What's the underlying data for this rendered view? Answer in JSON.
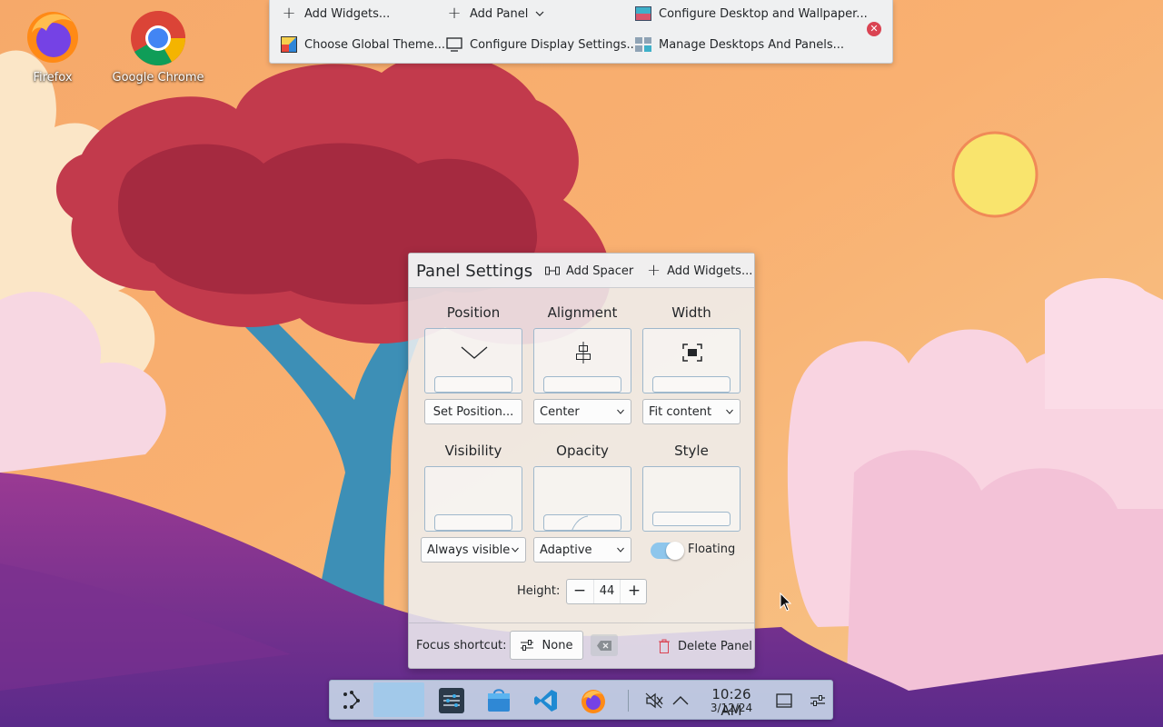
{
  "desktop": {
    "icons": [
      {
        "label": "Firefox",
        "icon": "firefox-icon"
      },
      {
        "label": "Google Chrome",
        "icon": "chrome-icon"
      }
    ]
  },
  "edit_toolbar": {
    "add_widgets": "Add Widgets...",
    "add_panel": "Add Panel",
    "configure_desktop": "Configure Desktop and Wallpaper...",
    "choose_theme": "Choose Global Theme...",
    "configure_display": "Configure Display Settings...",
    "manage_desktops": "Manage Desktops And Panels..."
  },
  "panel_settings": {
    "title": "Panel Settings",
    "add_spacer": "Add Spacer",
    "add_widgets": "Add Widgets...",
    "position": {
      "title": "Position",
      "button": "Set Position..."
    },
    "alignment": {
      "title": "Alignment",
      "value": "Center"
    },
    "width": {
      "title": "Width",
      "value": "Fit content"
    },
    "visibility": {
      "title": "Visibility",
      "value": "Always visible"
    },
    "opacity": {
      "title": "Opacity",
      "value": "Adaptive"
    },
    "style": {
      "title": "Style",
      "floating_label": "Floating",
      "floating_on": true
    },
    "height": {
      "label": "Height:",
      "value": "44"
    },
    "footer": {
      "focus_label": "Focus shortcut:",
      "shortcut_value": "None",
      "delete_label": "Delete Panel"
    }
  },
  "taskbar": {
    "time": "10:26 AM",
    "date": "3/12/24",
    "items": [
      "app-launcher-icon",
      "pager-icon",
      "system-settings-icon",
      "discover-icon",
      "vscode-icon",
      "firefox-icon",
      "volume-muted-icon",
      "tray-expand-icon",
      "show-desktop-icon",
      "panel-configure-icon"
    ]
  },
  "colors": {
    "accent": "#3daee9",
    "close_red": "#da4453",
    "toolbar_bg": "#eff0f1"
  }
}
